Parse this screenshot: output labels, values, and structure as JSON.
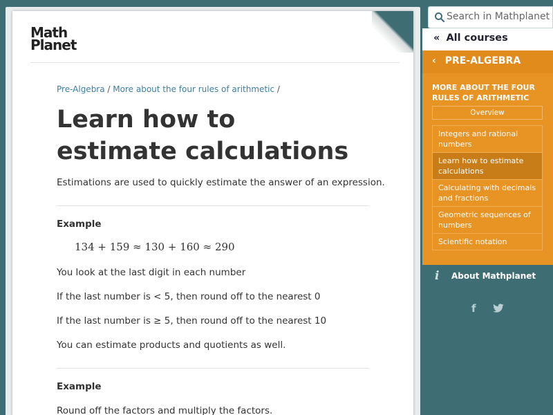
{
  "logo": {
    "line1": "Math",
    "line2": "Planet"
  },
  "breadcrumb": {
    "items": [
      "Pre-Algebra",
      "More about the four rules of arithmetic"
    ],
    "separator": "/"
  },
  "main": {
    "title": "Learn how to estimate calculations",
    "intro": "Estimations are used to quickly estimate the answer of an expression.",
    "example1_heading": "Example",
    "formula": "134 + 159 ≈ 130 + 160 ≈ 290",
    "p1": "You look at the last digit in each number",
    "p2": "If the last number is < 5, then round off to the nearest 0",
    "p3": "If the last number is ≥ 5, then round off to the nearest 10",
    "p4": "You can estimate products and quotients as well.",
    "example2_heading": "Example",
    "p5": "Round off the factors and multiply the factors."
  },
  "sidebar": {
    "search_placeholder": "Search in Mathplanet",
    "all_courses": "All courses",
    "course": "PRE-ALGEBRA",
    "section_title": "MORE ABOUT THE FOUR RULES OF ARITHMETIC",
    "overview": "Overview",
    "items": [
      {
        "label": "Integers and rational numbers",
        "active": false
      },
      {
        "label": "Learn how to estimate calculations",
        "active": true
      },
      {
        "label": "Calculating with decimals and fractions",
        "active": false
      },
      {
        "label": "Geometric sequences of numbers",
        "active": false
      },
      {
        "label": "Scientific notation",
        "active": false
      }
    ],
    "about": "About Mathplanet"
  },
  "colors": {
    "background": "#3e6e74",
    "orange": "#e89424",
    "active_item": "#c97d18",
    "link": "#3b7fa0"
  },
  "icons": [
    "search-icon",
    "double-chevron-left-icon",
    "chevron-left-icon",
    "info-icon",
    "facebook-icon",
    "twitter-icon"
  ]
}
